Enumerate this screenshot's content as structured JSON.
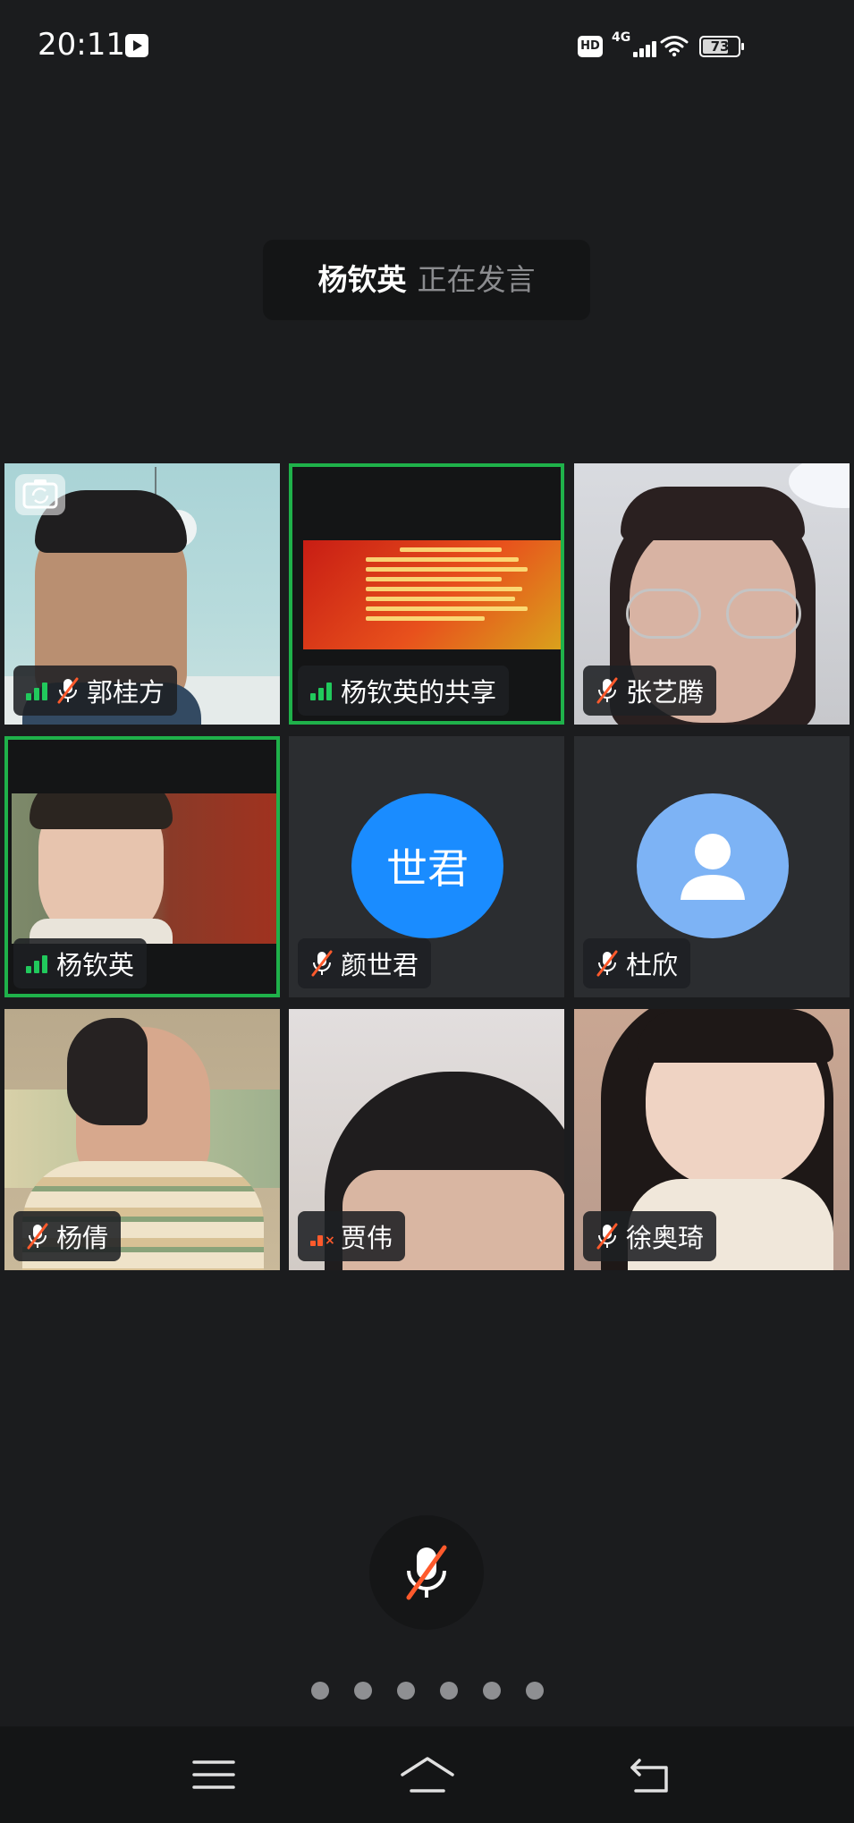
{
  "status_bar": {
    "time": "20:11",
    "hd": "HD",
    "network": "4G",
    "battery": "73",
    "battery_level": 0.73
  },
  "speaker_banner": {
    "name": "杨钦英",
    "status": "正在发言"
  },
  "participants": [
    {
      "name": "郭桂方",
      "mic_muted": true,
      "signal": "good"
    },
    {
      "name": "杨钦英的共享",
      "mic_muted": false,
      "signal": "good",
      "active": true,
      "content": "screen-share"
    },
    {
      "name": "张艺腾",
      "mic_muted": true,
      "signal": "none"
    },
    {
      "name": "杨钦英",
      "mic_muted": false,
      "signal": "good",
      "active": true
    },
    {
      "name": "颜世君",
      "mic_muted": true,
      "signal": "none",
      "avatar_text": "世君",
      "avatar_color": "#1a8cff"
    },
    {
      "name": "杜欣",
      "mic_muted": true,
      "signal": "none",
      "avatar_icon": "person-icon",
      "avatar_color": "#7db3f5"
    },
    {
      "name": "杨倩",
      "mic_muted": true,
      "signal": "none"
    },
    {
      "name": "贾伟",
      "mic_muted": false,
      "signal": "poor"
    },
    {
      "name": "徐奥琦",
      "mic_muted": true,
      "signal": "none"
    }
  ],
  "controls": {
    "mic_button_icon": "mic-off-icon",
    "page_count": 6
  },
  "nav_bar": {
    "menu_icon": "menu-icon",
    "home_icon": "home-icon",
    "back_icon": "back-icon"
  },
  "colors": {
    "active_border": "#1fb14a",
    "signal_good": "#21c95c",
    "signal_poor": "#ff5a2c",
    "mic_muted": "#ff5a2c"
  }
}
